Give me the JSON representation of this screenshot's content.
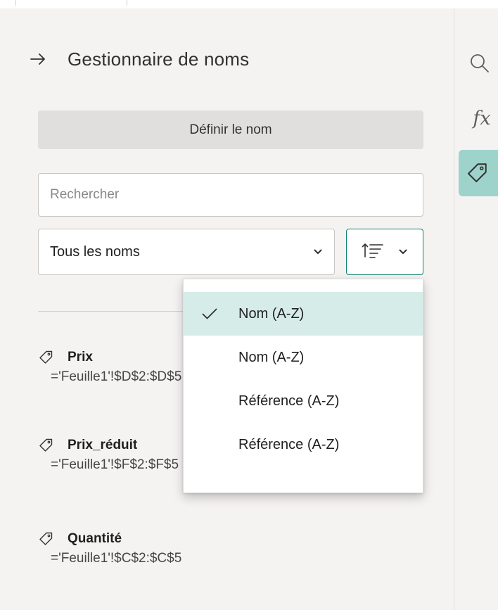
{
  "panel": {
    "title": "Gestionnaire de noms",
    "define_button": "Définir le nom",
    "search_placeholder": "Rechercher",
    "filter_selected": "Tous les noms"
  },
  "names": [
    {
      "name": "Prix",
      "reference": "='Feuille1'!$D$2:$D$5"
    },
    {
      "name": "Prix_réduit",
      "reference": "='Feuille1'!$F$2:$F$5"
    },
    {
      "name": "Quantité",
      "reference": "='Feuille1'!$C$2:$C$5"
    }
  ],
  "sort_menu": {
    "items": [
      {
        "label": "Nom (A-Z)",
        "selected": true
      },
      {
        "label": "Nom (A-Z)",
        "selected": false
      },
      {
        "label": "Référence (A-Z)",
        "selected": false
      },
      {
        "label": "Référence (A-Z)",
        "selected": false
      }
    ]
  },
  "rail": {
    "fx_label": "fx"
  },
  "colors": {
    "accent": "#108272",
    "selected_bg": "#d5ece9",
    "rail_active": "#9ed3cb"
  },
  "icons": [
    "arrow-right-icon",
    "chevron-down-icon",
    "sort-icon",
    "tag-icon",
    "check-icon",
    "search-icon",
    "function-icon"
  ]
}
